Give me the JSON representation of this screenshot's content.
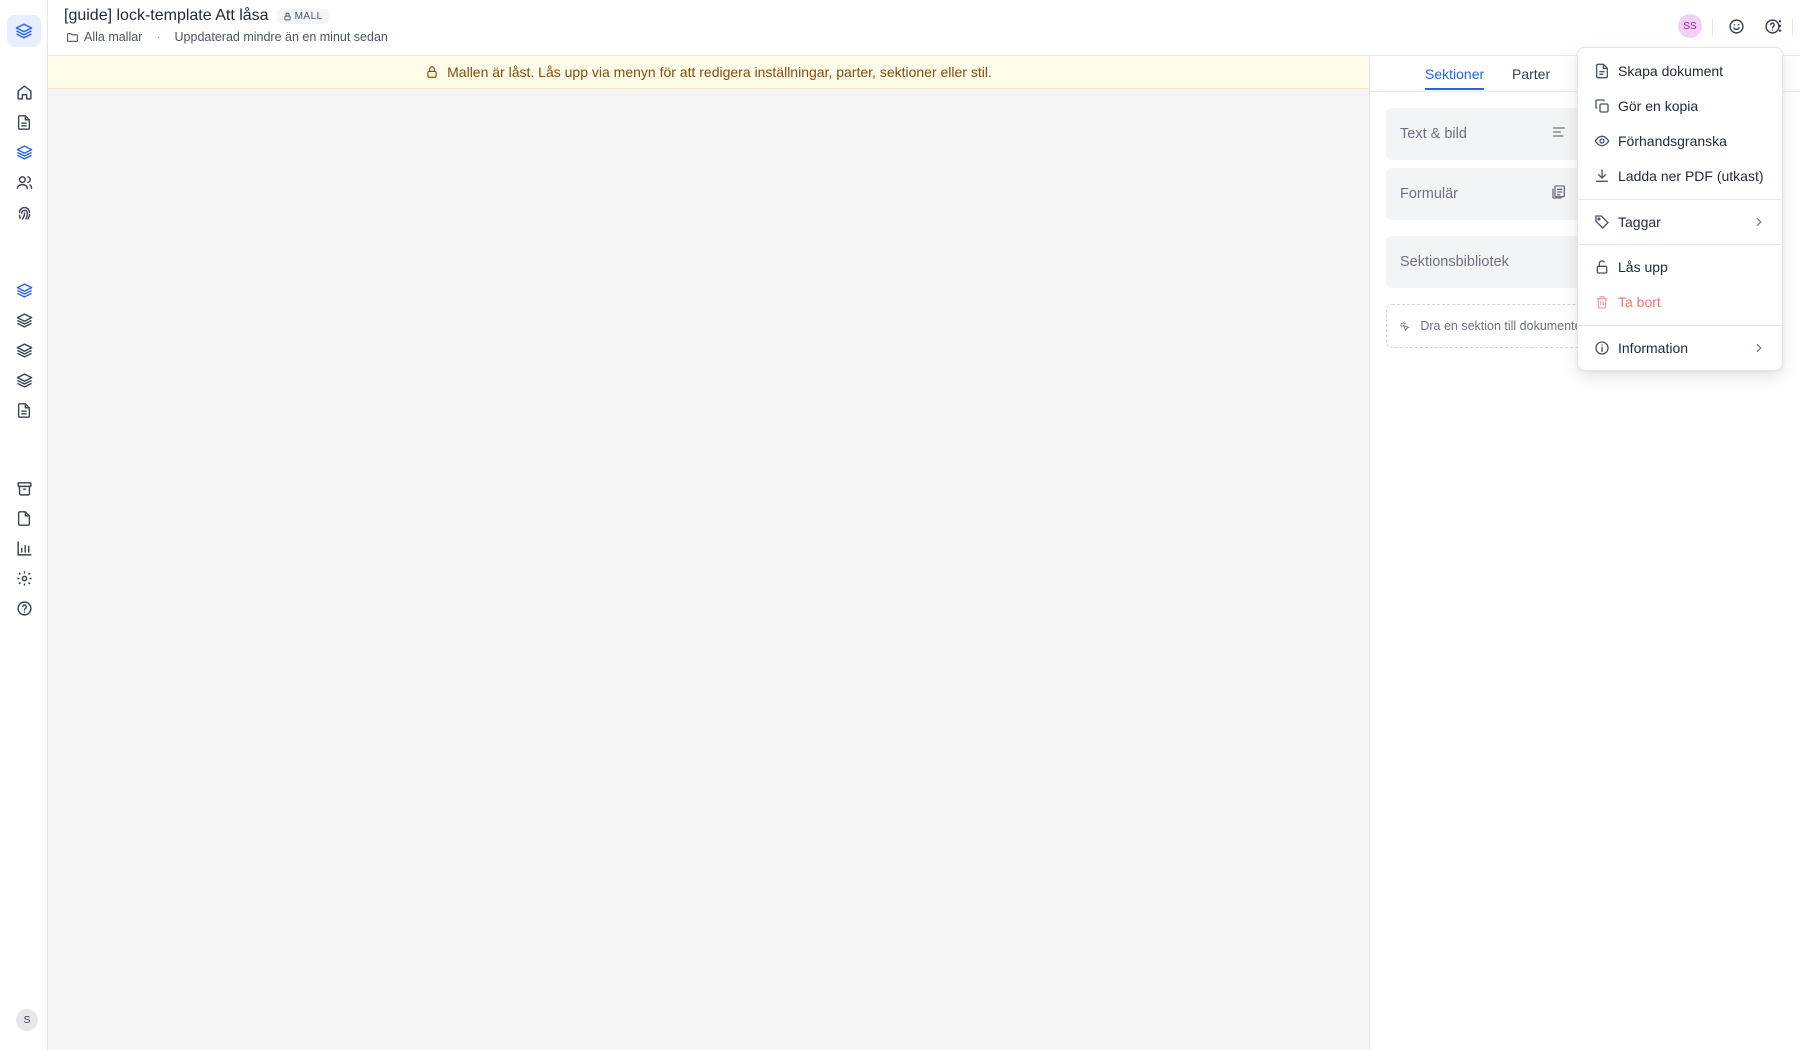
{
  "header": {
    "title": "[guide] lock-template Att låsa",
    "badge": "MALL",
    "breadcrumb_folder": "Alla mallar",
    "separator": "·",
    "updated": "Uppdaterad mindre än en minut sedan",
    "avatar_initials": "SS"
  },
  "banner": {
    "text": "Mallen är låst. Lås upp via menyn för att redigera inställningar, parter, sektioner eller stil."
  },
  "right_panel": {
    "tabs": [
      {
        "label": "Sektioner",
        "active": true
      },
      {
        "label": "Parter",
        "active": false
      }
    ],
    "cards": [
      {
        "label": "Text & bild",
        "icon": "align-left-icon"
      },
      {
        "label": "Formulär",
        "icon": "form-icon"
      },
      {
        "label": "Sektionsbibliotek",
        "icon": ""
      }
    ],
    "drop_hint": "Dra en sektion till dokumentet"
  },
  "menu": {
    "items": [
      {
        "label": "Skapa dokument",
        "icon": "document-icon"
      },
      {
        "label": "Gör en kopia",
        "icon": "copy-icon"
      },
      {
        "label": "Förhandsgranska",
        "icon": "eye-icon"
      },
      {
        "label": "Ladda ner PDF (utkast)",
        "icon": "download-icon"
      },
      {
        "label": "Taggar",
        "icon": "tag-icon",
        "submenu": true
      },
      {
        "label": "Lås upp",
        "icon": "unlock-icon"
      },
      {
        "label": "Ta bort",
        "icon": "trash-icon",
        "danger": true
      },
      {
        "label": "Information",
        "icon": "info-icon",
        "submenu": true
      }
    ]
  },
  "sidebar": {
    "user_initial": "S",
    "icons": [
      "home-icon",
      "document-icon",
      "templates-icon",
      "contacts-icon",
      "fingerprint-icon",
      "layers-icon",
      "layers-icon",
      "layers-icon",
      "layers-icon",
      "document-icon",
      "archive-icon",
      "file-icon",
      "chart-icon",
      "settings-icon",
      "help-icon"
    ]
  },
  "colors": {
    "accent": "#2563eb",
    "banner_bg": "#fefbe8",
    "banner_text": "#854d0e",
    "danger": "#f87171",
    "avatar_bg": "#f3d1f4"
  }
}
